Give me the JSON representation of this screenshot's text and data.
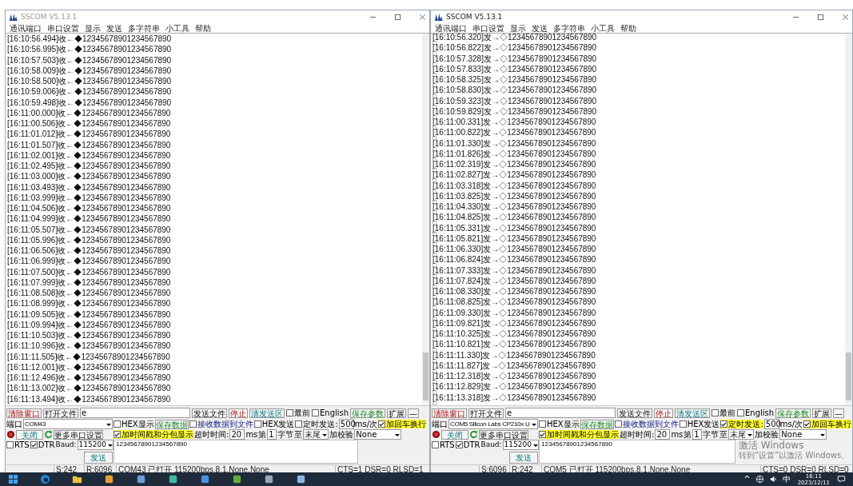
{
  "windows": [
    {
      "title": "SSCOM V5.13.1",
      "active": false,
      "menu": [
        "通讯端口",
        "串口设置",
        "显示",
        "发送",
        "多字符串",
        "小工具",
        "帮助"
      ],
      "log": [
        {
          "text": "[16:10:56.494]收←◆12345678901234567890"
        },
        {
          "text": "[16:10:56.995]收←◆12345678901234567890"
        },
        {
          "text": "[16:10:57.503]收←◆12345678901234567890"
        },
        {
          "text": "[16:10:58.009]收←◆12345678901234567890"
        },
        {
          "text": "[16:10:58.500]收←◆12345678901234567890"
        },
        {
          "text": "[16:10:59.006]收←◆12345678901234567890"
        },
        {
          "text": "[16:10:59.498]收←◆12345678901234567890"
        },
        {
          "text": "[16:11:00.000]收←◆12345678901234567890"
        },
        {
          "text": "[16:11:00.506]收←◆12345678901234567890"
        },
        {
          "text": "[16:11:01.012]收←◆12345678901234567890"
        },
        {
          "text": "[16:11:01.507]收←◆12345678901234567890"
        },
        {
          "text": "[16:11:02.001]收←◆12345678901234567890"
        },
        {
          "text": "[16:11:02.495]收←◆12345678901234567890"
        },
        {
          "text": "[16:11:03.000]收←◆12345678901234567890"
        },
        {
          "text": "[16:11:03.493]收←◆12345678901234567890"
        },
        {
          "text": "[16:11:03.999]收←◆12345678901234567890"
        },
        {
          "text": "[16:11:04.506]收←◆12345678901234567890"
        },
        {
          "text": "[16:11:04.999]收←◆12345678901234567890"
        },
        {
          "text": "[16:11:05.507]收←◆12345678901234567890"
        },
        {
          "text": "[16:11:05.996]收←◆12345678901234567890"
        },
        {
          "text": "[16:11:06.506]收←◆12345678901234567890"
        },
        {
          "text": "[16:11:06.999]收←◆12345678901234567890"
        },
        {
          "text": "[16:11:07.500]收←◆12345678901234567890"
        },
        {
          "text": "[16:11:07.999]收←◆12345678901234567890"
        },
        {
          "text": "[16:11:08.508]收←◆12345678901234567890"
        },
        {
          "text": "[16:11:08.999]收←◆12345678901234567890"
        },
        {
          "text": "[16:11:09.505]收←◆12345678901234567890"
        },
        {
          "text": "[16:11:09.994]收←◆12345678901234567890"
        },
        {
          "text": "[16:11:10.503]收←◆12345678901234567890"
        },
        {
          "text": "[16:11:10.996]收←◆12345678901234567890"
        },
        {
          "text": "[16:11:11.505]收←◆12345678901234567890"
        },
        {
          "text": "[16:11:12.001]收←◆12345678901234567890"
        },
        {
          "text": "[16:11:12.496]收←◆12345678901234567890"
        },
        {
          "text": "[16:11:13.002]收←◆12345678901234567890"
        },
        {
          "text": "[16:11:13.494]收←◆12345678901234567890"
        }
      ],
      "clear_window": "清除窗口",
      "open_file": "打开文件",
      "file_path": "e",
      "send_file": "发送文件",
      "stop": "停止",
      "clear_send": "清发送区",
      "topmost": {
        "label": "最前",
        "checked": false
      },
      "english": {
        "label": "English",
        "checked": false
      },
      "save_params": "保存参数",
      "expand": "扩展",
      "collapse": "—",
      "port_label": "端口",
      "port": "COM43",
      "hex_display": {
        "label": "HEX显示",
        "checked": false
      },
      "save_data": "保存数据",
      "recv_to_file": {
        "label": "接收数据到文件",
        "checked": false
      },
      "hex_send": {
        "label": "HEX发送",
        "checked": false
      },
      "timed_send": {
        "label": "定时发送:",
        "checked": false
      },
      "interval": "500",
      "interval_unit": "ms/次",
      "add_crlf": {
        "label": "加回车换行",
        "checked": true
      },
      "close_port": "关闭",
      "more_settings": "更多串口设置",
      "timestamp": {
        "label": "加时间戳和分包显示",
        "checked": true
      },
      "timeout_label": "超时时间:",
      "timeout": "20",
      "timeout_unit": "ms",
      "byte_label": "第",
      "byte_from": "1",
      "byte_unit": "字节",
      "to_label": "至",
      "to_value": "末尾",
      "checksum_label": "加校验",
      "checksum": "None",
      "rts": {
        "label": "RTS",
        "checked": false
      },
      "dtr": {
        "label": "DTR",
        "checked": true
      },
      "baud_label": "Baud:",
      "baud": "115200",
      "send_text": "12345678901234567890",
      "send": "发送",
      "status": [
        "S:242",
        "R:6096",
        "COM43 已打开 115200bps,8,1,None,None",
        "CTS=1 DSR=0 RLSD=1"
      ]
    },
    {
      "title": "SSCOM V5.13.1",
      "active": true,
      "menu": [
        "通讯端口",
        "串口设置",
        "显示",
        "发送",
        "多字符串",
        "小工具",
        "帮助"
      ],
      "log": [
        {
          "text": "[16:10:56.320]发→◇12345678901234567890",
          "tail": "□"
        },
        {
          "text": "[16:10:56.822]发→◇12345678901234567890",
          "tail": "□"
        },
        {
          "text": "[16:10:57.328]发→◇12345678901234567890",
          "tail": "□"
        },
        {
          "text": "[16:10:57.833]发→◇12345678901234567890",
          "tail": "□"
        },
        {
          "text": "[16:10:58.325]发→◇12345678901234567890",
          "tail": "□"
        },
        {
          "text": "[16:10:58.830]发→◇12345678901234567890",
          "tail": "□"
        },
        {
          "text": "[16:10:59.323]发→◇12345678901234567890",
          "tail": "□"
        },
        {
          "text": "[16:10:59.829]发→◇12345678901234567890",
          "tail": "□"
        },
        {
          "text": "[16:11:00.331]发→◇12345678901234567890",
          "tail": "□"
        },
        {
          "text": "[16:11:00.822]发→◇12345678901234567890",
          "tail": "□"
        },
        {
          "text": "[16:11:01.330]发→◇12345678901234567890",
          "tail": "□"
        },
        {
          "text": "[16:11:01.826]发→◇12345678901234567890",
          "tail": "□"
        },
        {
          "text": "[16:11:02.319]发→◇12345678901234567890",
          "tail": "□"
        },
        {
          "text": "[16:11:02.827]发→◇12345678901234567890",
          "tail": "□"
        },
        {
          "text": "[16:11:03.318]发→◇12345678901234567890",
          "tail": "□"
        },
        {
          "text": "[16:11:03.825]发→◇12345678901234567890",
          "tail": "□"
        },
        {
          "text": "[16:11:04.330]发→◇12345678901234567890",
          "tail": "□"
        },
        {
          "text": "[16:11:04.825]发→◇12345678901234567890",
          "tail": "□"
        },
        {
          "text": "[16:11:05.331]发→◇12345678901234567890",
          "tail": "□"
        },
        {
          "text": "[16:11:05.821]发→◇12345678901234567890",
          "tail": "□"
        },
        {
          "text": "[16:11:06.330]发→◇12345678901234567890",
          "tail": "□"
        },
        {
          "text": "[16:11:06.824]发→◇12345678901234567890",
          "tail": "□"
        },
        {
          "text": "[16:11:07.333]发→◇12345678901234567890",
          "tail": "□"
        },
        {
          "text": "[16:11:07.824]发→◇12345678901234567890",
          "tail": "□"
        },
        {
          "text": "[16:11:08.330]发→◇12345678901234567890",
          "tail": "□"
        },
        {
          "text": "[16:11:08.825]发→◇12345678901234567890",
          "tail": "□"
        },
        {
          "text": "[16:11:09.330]发→◇12345678901234567890",
          "tail": "□"
        },
        {
          "text": "[16:11:09.821]发→◇12345678901234567890",
          "tail": "□"
        },
        {
          "text": "[16:11:10.325]发→◇12345678901234567890",
          "tail": "□"
        },
        {
          "text": "[16:11:10.821]发→◇12345678901234567890",
          "tail": "□"
        },
        {
          "text": "[16:11:11.330]发→◇12345678901234567890",
          "tail": "□"
        },
        {
          "text": "[16:11:11.827]发→◇12345678901234567890",
          "tail": "□"
        },
        {
          "text": "[16:11:12.318]发→◇12345678901234567890",
          "tail": "□"
        },
        {
          "text": "[16:11:12.829]发→◇12345678901234567890",
          "tail": "□"
        },
        {
          "text": "[16:11:13.318]发→◇12345678901234567890",
          "tail": "□"
        }
      ],
      "clear_window": "清除窗口",
      "open_file": "打开文件",
      "file_path": "e",
      "send_file": "发送文件",
      "stop": "停止",
      "clear_send": "清发送区",
      "topmost": {
        "label": "最前",
        "checked": false
      },
      "english": {
        "label": "English",
        "checked": false
      },
      "save_params": "保存参数",
      "expand": "扩展",
      "collapse": "—",
      "port_label": "端口",
      "port": "COM5 Silicon Labs CP210x U",
      "hex_display": {
        "label": "HEX显示",
        "checked": false
      },
      "save_data": "保存数据",
      "recv_to_file": {
        "label": "接收数据到文件",
        "checked": false
      },
      "hex_send": {
        "label": "HEX发送",
        "checked": false
      },
      "timed_send": {
        "label": "定时发送:",
        "checked": true
      },
      "interval": "500",
      "interval_unit": "ms/次",
      "add_crlf": {
        "label": "加回车换行",
        "checked": true
      },
      "close_port": "关闭",
      "more_settings": "更多串口设置",
      "timestamp": {
        "label": "加时间戳和分包显示",
        "checked": true
      },
      "timeout_label": "超时时间:",
      "timeout": "20",
      "timeout_unit": "ms",
      "byte_label": "第",
      "byte_from": "1",
      "byte_unit": "字节",
      "to_label": "至",
      "to_value": "末尾",
      "checksum_label": "加校验",
      "checksum": "None",
      "rts": {
        "label": "RTS",
        "checked": false
      },
      "dtr": {
        "label": "DTR",
        "checked": true
      },
      "baud_label": "Baud:",
      "baud": "115200",
      "send_text": "12345678901234567890",
      "send": "发送",
      "status": [
        "S:6096",
        "R:242",
        "COM5 已打开 115200bps,8,1,None,None",
        "CTS=0 DSR=0 RLSD=0"
      ],
      "activation_notice": {
        "title": "激活 Windows",
        "text": "转到“设置”以激活 Windows。"
      }
    }
  ],
  "taskbar": {
    "tray_chevron": "^",
    "ime": "中",
    "time": "16:11",
    "date": "2023/12/11"
  }
}
